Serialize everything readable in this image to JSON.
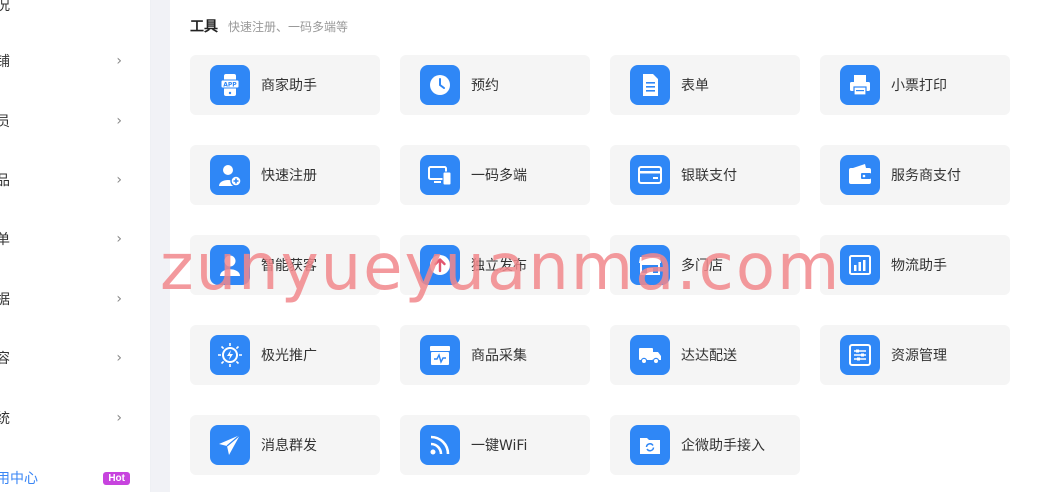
{
  "sidebar": {
    "items": [
      {
        "label": "况",
        "chevron": false
      },
      {
        "label": "铺",
        "chevron": true
      },
      {
        "label": "员",
        "chevron": true
      },
      {
        "label": "品",
        "chevron": true
      },
      {
        "label": "单",
        "chevron": true
      },
      {
        "label": "据",
        "chevron": true
      },
      {
        "label": "容",
        "chevron": true
      },
      {
        "label": "统",
        "chevron": true
      },
      {
        "label": "用中心",
        "chevron": false,
        "badge": "Hot"
      }
    ],
    "chevron_glyph": "›"
  },
  "tools": {
    "title": "工具",
    "subtitle": "快速注册、一码多端等",
    "cards": [
      {
        "label": "商家助手",
        "icon": "app-phone-icon"
      },
      {
        "label": "预约",
        "icon": "clock-icon"
      },
      {
        "label": "表单",
        "icon": "form-document-icon"
      },
      {
        "label": "小票打印",
        "icon": "printer-icon"
      },
      {
        "label": "快速注册",
        "icon": "user-add-icon"
      },
      {
        "label": "一码多端",
        "icon": "multi-device-icon"
      },
      {
        "label": "银联支付",
        "icon": "bank-card-icon"
      },
      {
        "label": "服务商支付",
        "icon": "wallet-icon"
      },
      {
        "label": "智能获客",
        "icon": "user-icon"
      },
      {
        "label": "独立发布",
        "icon": "upload-icon"
      },
      {
        "label": "多门店",
        "icon": "store-icon"
      },
      {
        "label": "物流助手",
        "icon": "logistics-chart-icon"
      },
      {
        "label": "极光推广",
        "icon": "lightning-icon"
      },
      {
        "label": "商品采集",
        "icon": "collect-box-icon"
      },
      {
        "label": "达达配送",
        "icon": "delivery-truck-icon"
      },
      {
        "label": "资源管理",
        "icon": "sliders-icon"
      },
      {
        "label": "消息群发",
        "icon": "paper-plane-icon"
      },
      {
        "label": "一键WiFi",
        "icon": "wifi-icon"
      },
      {
        "label": "企微助手接入",
        "icon": "folder-sync-icon"
      }
    ]
  },
  "watermark": "zunyueyuanma.com",
  "colors": {
    "accent": "#2f87f6",
    "card_bg": "#f5f5f5",
    "hot_badge": "#c743de",
    "watermark": "#f2888c"
  }
}
